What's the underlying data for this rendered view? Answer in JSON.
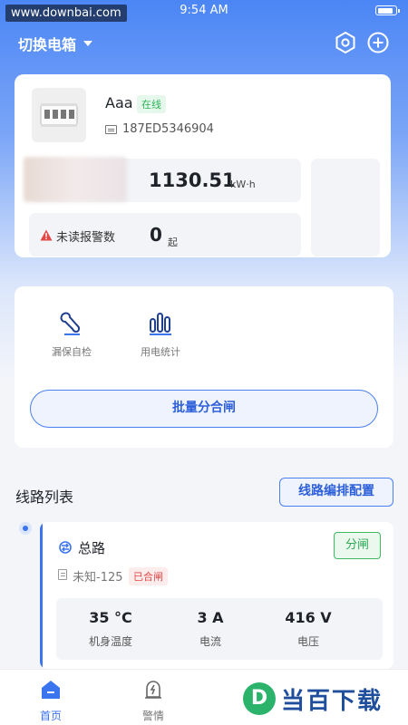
{
  "status_bar": {
    "time": "9:54 AM",
    "watermark": "www.downbai.com"
  },
  "header": {
    "title": "切换电箱"
  },
  "device": {
    "name": "Aaa",
    "status": "在线",
    "id": "187ED5346904",
    "energy_value": "1130.51",
    "energy_unit": "kW·h",
    "alarm_label": "未读报警数",
    "alarm_count": "0",
    "alarm_unit": "起"
  },
  "functions": [
    {
      "label": "漏保自检"
    },
    {
      "label": "用电统计"
    }
  ],
  "batch_button": "批量分合闸",
  "lines_section": {
    "title": "线路列表",
    "config_button": "线路编排配置"
  },
  "line": {
    "name": "总路",
    "action_button": "分闸",
    "model": "未知-125",
    "state_badge": "已合闸",
    "stats": [
      {
        "value": "35 °C",
        "label": "机身温度"
      },
      {
        "value": "3 A",
        "label": "电流"
      },
      {
        "value": "416 V",
        "label": "电压"
      }
    ]
  },
  "tabs": [
    {
      "label": "首页",
      "active": true
    },
    {
      "label": "警情",
      "active": false
    }
  ],
  "logo_watermark": {
    "badge": "D",
    "text": "当百下载"
  },
  "colors": {
    "accent": "#3a74ef",
    "online": "#2fb35c",
    "closed": "#e04848"
  }
}
